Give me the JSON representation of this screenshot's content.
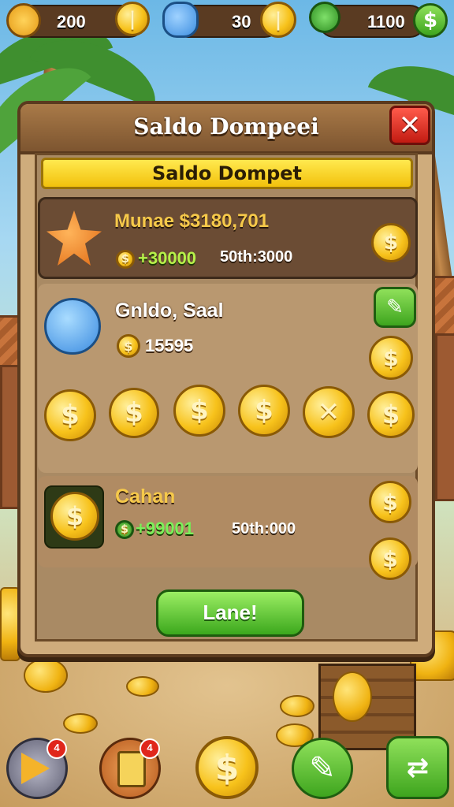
{
  "top_bar": {
    "resources": [
      {
        "name": "badge-resource",
        "value": "200",
        "icon": "coin-icon"
      },
      {
        "name": "gem-resource",
        "value": "30",
        "icon": "coin-icon"
      },
      {
        "name": "energy-resource",
        "value": "1100",
        "icon": "dollar-icon"
      }
    ]
  },
  "panel": {
    "title": "Saldo Dompeei",
    "banner": "Saldo Dompet",
    "close_symbol": "✕",
    "rows": [
      {
        "title": "Munae $3180,701",
        "amount": "30000",
        "secondary": "50th:3000"
      },
      {
        "title": "Gnldo, Saal",
        "amount": "15595"
      },
      {
        "title": "Cahan",
        "amount": "+9900",
        "amount_suffix": "1",
        "secondary": "50th:000"
      }
    ],
    "coin_row_symbols": [
      "$",
      "$",
      "$",
      "$",
      "✕",
      "$"
    ],
    "action_button": "Lane!"
  },
  "bottom_nav": {
    "badges": [
      "4",
      "4"
    ]
  },
  "colors": {
    "accent_green": "#3ea51e",
    "gold": "#f7c21b",
    "panel_brown": "#5a3a1e",
    "close_red": "#c21b12"
  }
}
